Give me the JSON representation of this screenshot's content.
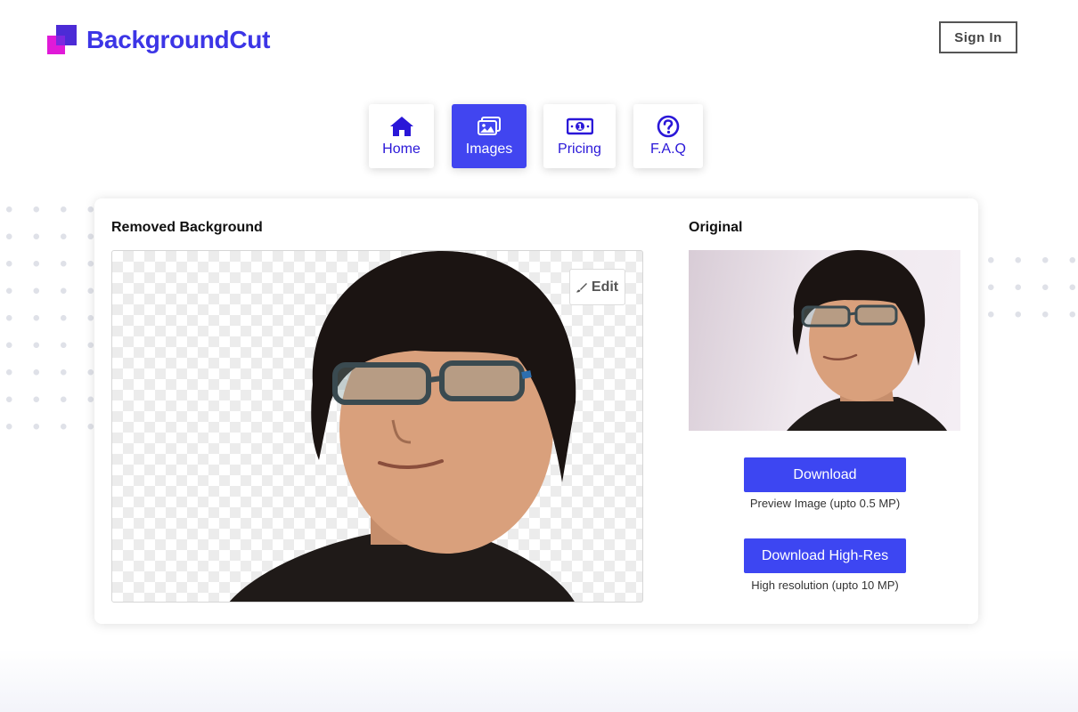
{
  "brand": {
    "name": "BackgroundCut"
  },
  "header": {
    "sign_in_label": "Sign In"
  },
  "nav": {
    "tabs": [
      {
        "label": "Home",
        "icon": "home-icon"
      },
      {
        "label": "Images",
        "icon": "images-icon",
        "active": true
      },
      {
        "label": "Pricing",
        "icon": "banknote-icon"
      },
      {
        "label": "F.A.Q",
        "icon": "question-circle-icon"
      }
    ]
  },
  "result": {
    "removed_title": "Removed Background",
    "original_title": "Original",
    "edit_label": "Edit",
    "download_label": "Download",
    "download_caption": "Preview Image (upto 0.5 MP)",
    "download_hires_label": "Download High-Res",
    "download_hires_caption": "High resolution (upto 10 MP)"
  },
  "colors": {
    "accent": "#3d46f2",
    "brand_text": "#3c35e6",
    "nav_icon": "#2a17d8",
    "logo_purple": "#4c2bd6",
    "logo_magenta": "#e01ad8"
  }
}
